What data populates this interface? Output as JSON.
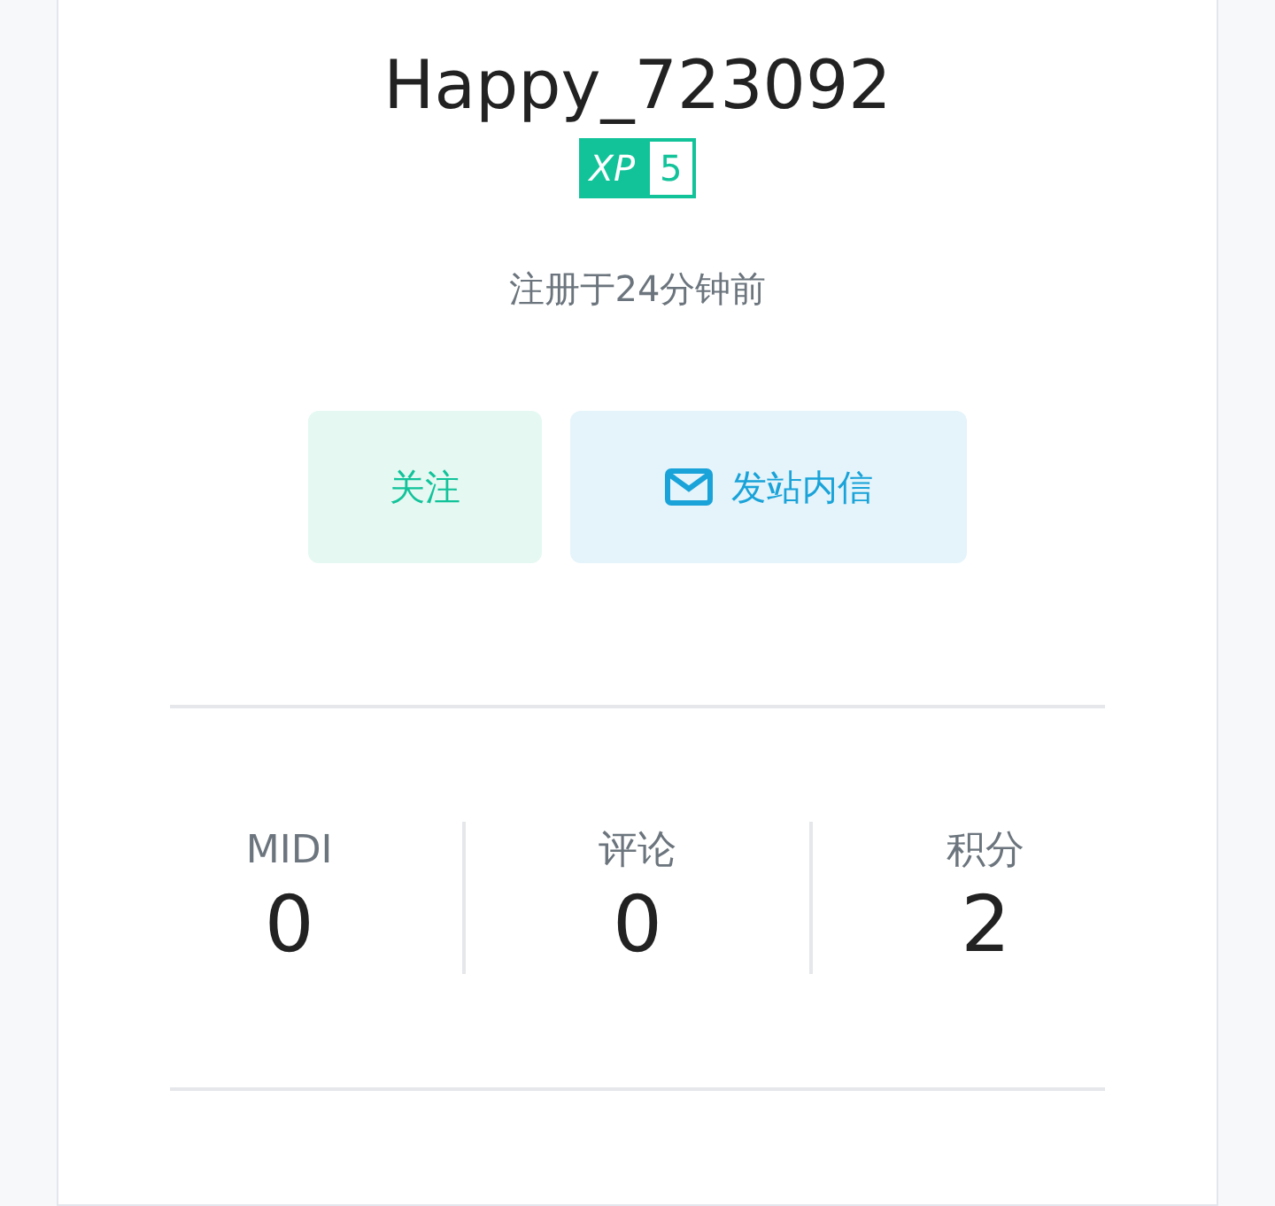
{
  "profile": {
    "username": "Happy_723092",
    "xp_label": "XP",
    "xp_value": "5",
    "registered": "注册于24分钟前"
  },
  "buttons": [
    {
      "kind": "follow",
      "label": "关注"
    },
    {
      "kind": "message",
      "label": "发站内信"
    }
  ],
  "stats": [
    {
      "label": "MIDI",
      "value": "0"
    },
    {
      "label": "评论",
      "value": "0"
    },
    {
      "label": "积分",
      "value": "2"
    }
  ]
}
